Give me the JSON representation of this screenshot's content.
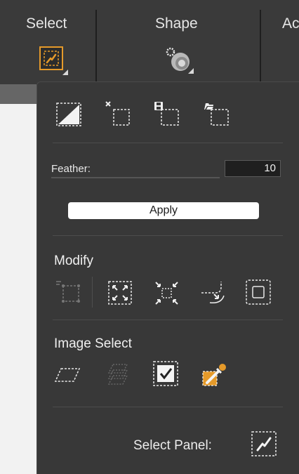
{
  "toolbar": {
    "select_label": "Select",
    "shape_label": "Shape",
    "next_label": "Ac"
  },
  "panel": {
    "feather": {
      "label": "Feather:",
      "value": "10"
    },
    "apply_label": "Apply",
    "modify_title": "Modify",
    "image_select_title": "Image Select",
    "select_panel_label": "Select Panel:"
  },
  "colors": {
    "accent_orange": "#e59a2a",
    "panel_bg": "#383838",
    "toolbar_bg": "#3a3a3a"
  },
  "icons": {
    "top_row": [
      "invert-selection-icon",
      "clear-selection-icon",
      "save-selection-icon",
      "load-selection-icon"
    ],
    "modify_row": [
      "modify-edge-icon",
      "expand-selection-icon",
      "contract-selection-icon",
      "smooth-selection-icon",
      "border-selection-icon"
    ],
    "image_select_row": [
      "parallelogram-select-icon",
      "layered-select-icon",
      "checkbox-select-icon",
      "color-picker-icon"
    ]
  }
}
